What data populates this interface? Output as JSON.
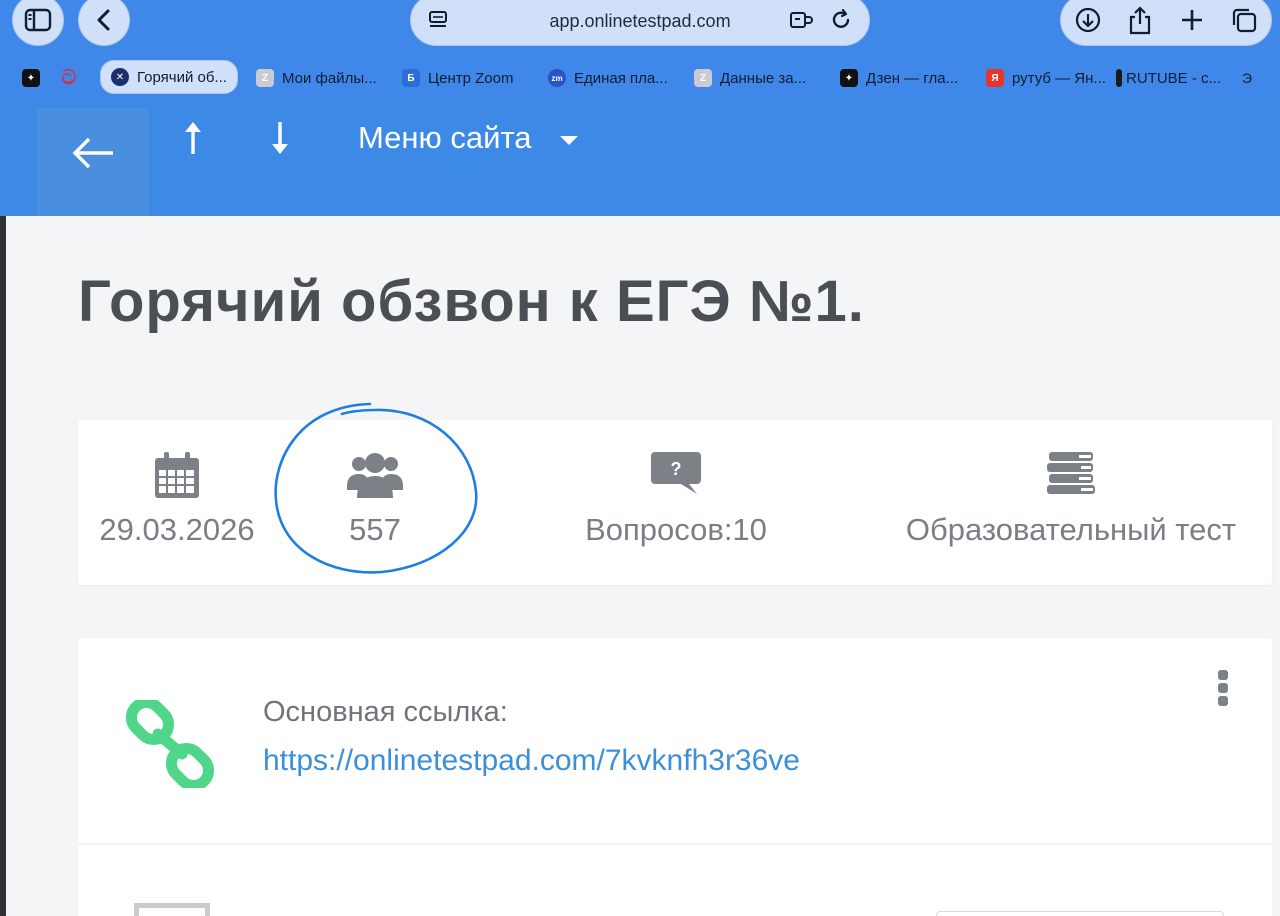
{
  "browser": {
    "url": "app.onlinetestpad.com",
    "tabs": [
      {
        "label": "Горячий об...",
        "active": true,
        "icon": "close-icon"
      },
      {
        "label": "Мои файлы...",
        "icon": "z-favicon"
      },
      {
        "label": "Центр Zoom",
        "icon": "zoom-favicon"
      },
      {
        "label": "Единая пла...",
        "icon": "zm-favicon"
      },
      {
        "label": "Данные за...",
        "icon": "z-favicon"
      },
      {
        "label": "Дзен — гла...",
        "icon": "dzen-favicon"
      },
      {
        "label": "рутуб — Ян...",
        "icon": "yandex-favicon"
      },
      {
        "label": "RUTUBE - с...",
        "icon": "rutube-favicon"
      }
    ]
  },
  "header": {
    "menu_label": "Меню сайта"
  },
  "test": {
    "title": "Горячий обзвон к ЕГЭ №1.",
    "stats": {
      "date": "29.03.2026",
      "participants": "557",
      "questions": "Вопросов:10",
      "type": "Образовательный тест"
    }
  },
  "link": {
    "label": "Основная ссылка:",
    "url": "https://onlinetestpad.com/7kvknfh3r36ve"
  },
  "colors": {
    "accent": "#3d8ae6",
    "link_green": "#4fd68a",
    "link_text": "#3c8fd9",
    "annotation": "#1f7fe0"
  }
}
